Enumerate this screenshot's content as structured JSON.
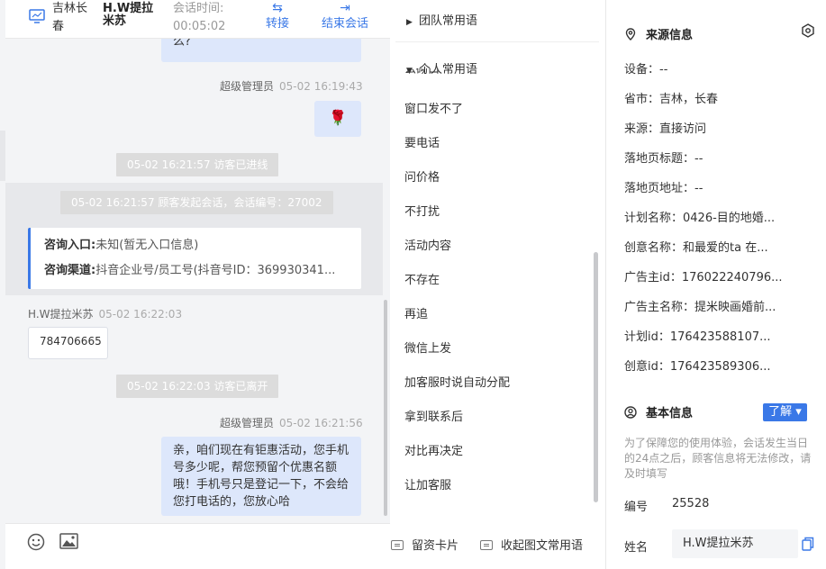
{
  "header": {
    "location": "吉林长春",
    "customer_name": "H.W提拉米苏",
    "session_time_label": "会话时间:",
    "session_time": "00:05:02",
    "transfer_label": "转接",
    "end_label": "结束会话"
  },
  "messages": {
    "partial_bubble": "么?",
    "m1_sender": "超级管理员",
    "m1_time": "05-02 16:19:43",
    "m1_emoji": "🌹",
    "sys1": "05-02 16:21:57 访客已进线",
    "sys2": "05-02 16:21:57 顾客发起会话，会话编号：27002",
    "card_entry_label": "咨询入口:",
    "card_entry_value": "未知(暂无入口信息)",
    "card_channel_label": "咨询渠道:",
    "card_channel_value": "抖音企业号/员工号(抖音号ID：369930341...",
    "m2_sender": "H.W提拉米苏",
    "m2_time": "05-02 16:22:03",
    "m2_text": "784706665",
    "sys3": "05-02 16:22:03 访客已离开",
    "m3_sender": "超级管理员",
    "m3_time": "05-02 16:21:56",
    "m3_text": "亲，咱们现在有钜惠活动，您手机号多少呢，帮您预留个优惠名额哦！手机号只是登记一下，不会给您打电话的，您放心哈"
  },
  "footer": {
    "emoji_icon": "emoji-icon",
    "image_icon": "image-icon",
    "leave_card": "留资卡片",
    "collapse_phrases": "收起图文常用语"
  },
  "phrases": {
    "team_group": "团队常用语",
    "personal_group": "个人常用语",
    "cut_item": "么砌口",
    "items": [
      "窗口发不了",
      "要电话",
      "问价格",
      "不打扰",
      "活动内容",
      "不存在",
      "再追",
      "微信上发",
      "加客服时说自动分配",
      "拿到联系后",
      "对比再决定",
      "让加客服"
    ]
  },
  "info": {
    "source_title": "来源信息",
    "rows": [
      "设备：--",
      "省市：吉林，长春",
      "来源：直接访问",
      "落地页标题：--",
      "落地页地址：--",
      "计划名称：0426-目的地婚...",
      "创意名称：和最爱的ta 在...",
      "广告主id：176022240796...",
      "广告主名称：提米映画婚前...",
      "计划id：176423588107...",
      "创意id：176423589306..."
    ],
    "basic_title": "基本信息",
    "learn_btn": "了解 ▾",
    "note": "为了保障您的使用体验，会话发生当日的24点之后，顾客信息将无法修改，请及时填写",
    "id_label": "编号",
    "id_value": "25528",
    "name_label": "姓名",
    "name_value": "H.W提拉米苏"
  },
  "colors": {
    "accent": "#3a78e7",
    "bubble": "#dde7fb",
    "chat_bg": "#f3f4f6"
  }
}
